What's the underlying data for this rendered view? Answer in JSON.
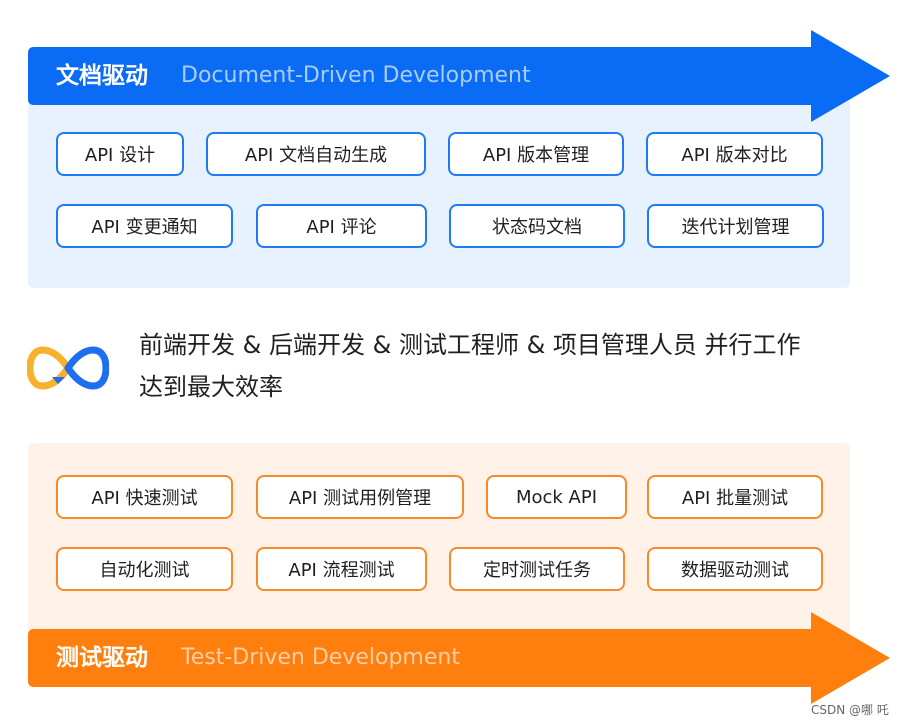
{
  "doc_section": {
    "title": "文档驱动",
    "subtitle": "Document-Driven Development",
    "color": "#0a6cf5",
    "items": [
      "API 设计",
      "API 文档自动生成",
      "API 版本管理",
      "API 版本对比",
      "API 变更通知",
      "API 评论",
      "状态码文档",
      "迭代计划管理"
    ]
  },
  "middle": {
    "line1": "前端开发 & 后端开发 & 测试工程师 & 项目管理人员 并行工作",
    "line2": "达到最大效率",
    "icon": "infinity-icon"
  },
  "test_section": {
    "title": "测试驱动",
    "subtitle": "Test-Driven Development",
    "color": "#ff7f0e",
    "items": [
      "API 快速测试",
      "API 测试用例管理",
      "Mock API",
      "API 批量测试",
      "自动化测试",
      "API 流程测试",
      "定时测试任务",
      "数据驱动测试"
    ]
  },
  "watermark": "CSDN @哪 吒"
}
